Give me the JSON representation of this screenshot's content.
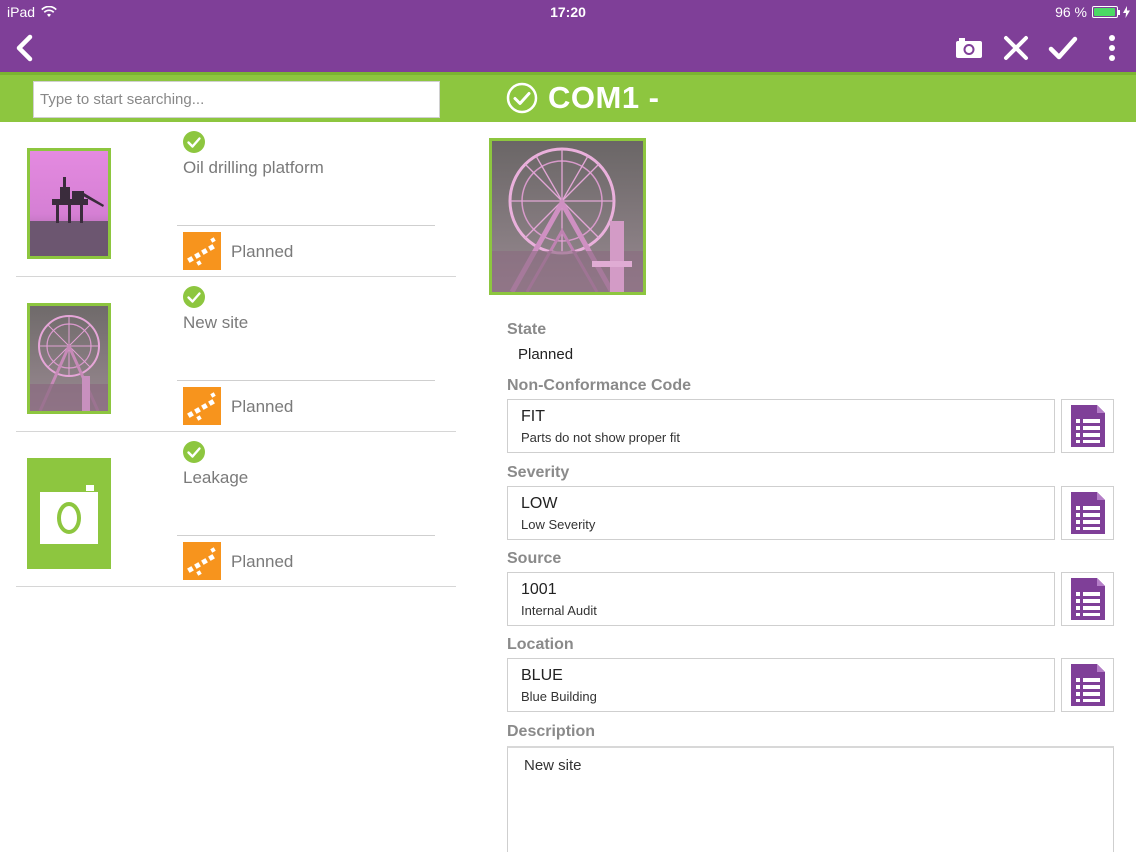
{
  "status_bar": {
    "carrier": "iPad",
    "time": "17:20",
    "battery": "96 %",
    "battery_level": 0.96
  },
  "toolbar": {
    "icons": [
      "chevron-left-icon",
      "camera-icon",
      "close-icon",
      "check-icon",
      "more-vertical-icon"
    ]
  },
  "search": {
    "placeholder": "Type to start searching...",
    "value": ""
  },
  "record": {
    "title": "COM1 -",
    "image": "ferris-wheel-photo"
  },
  "list": {
    "items": [
      {
        "title": "Oil drilling platform",
        "state": "Planned",
        "thumbnail": "oil-platform-photo"
      },
      {
        "title": "New site",
        "state": "Planned",
        "thumbnail": "ferris-wheel-photo"
      },
      {
        "title": "Leakage",
        "state": "Planned",
        "thumbnail": "camera-placeholder-icon"
      }
    ]
  },
  "detail": {
    "state": {
      "label": "State",
      "value": "Planned"
    },
    "non_conformance": {
      "label": "Non-Conformance Code",
      "code": "FIT",
      "description": "Parts do not show proper fit"
    },
    "severity": {
      "label": "Severity",
      "code": "LOW",
      "description": "Low Severity"
    },
    "source": {
      "label": "Source",
      "code": "1001",
      "description": "Internal Audit"
    },
    "location": {
      "label": "Location",
      "code": "BLUE",
      "description": "Blue Building"
    },
    "description": {
      "label": "Description",
      "value": "New site"
    }
  },
  "colors": {
    "purple": "#7f3f98",
    "green": "#8dc63f",
    "orange": "#f7941d",
    "label_gray": "#8a8a8a"
  }
}
